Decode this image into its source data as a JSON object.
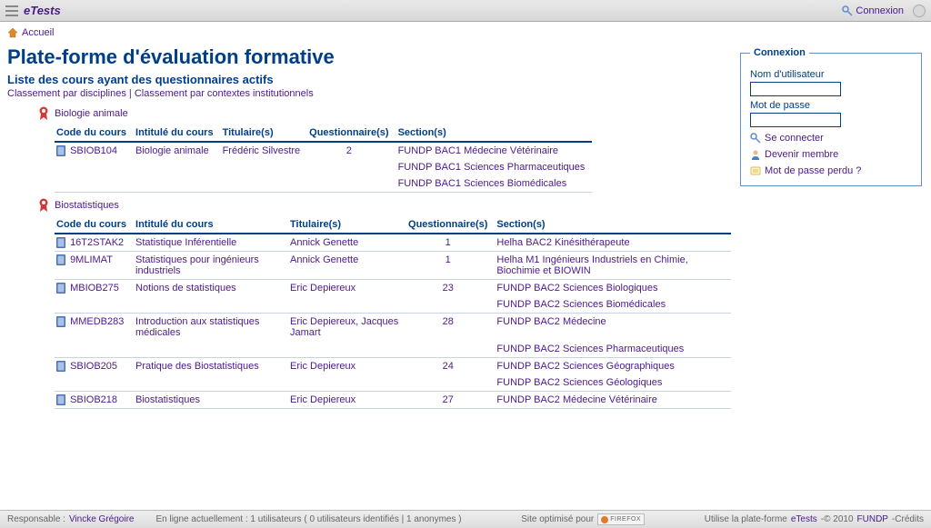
{
  "app": {
    "title": "eTests"
  },
  "titlebar": {
    "connexion": "Connexion"
  },
  "breadcrumb": {
    "home": "Accueil"
  },
  "page": {
    "h1": "Plate-forme d'évaluation formative",
    "h2": "Liste des cours ayant des questionnaires actifs",
    "sort_by_discipline": "Classement par disciplines",
    "sort_sep": " | ",
    "sort_by_context": "Classement par contextes institutionnels"
  },
  "headers": {
    "code": "Code du cours",
    "title": "Intitulé du cours",
    "holders": "Titulaire(s)",
    "quizzes": "Questionnaire(s)",
    "sections": "Section(s)"
  },
  "disciplines": [
    {
      "name": "Biologie animale",
      "courses": [
        {
          "code": "SBIOB104",
          "title": "Biologie animale",
          "holders": "Frédéric Silvestre",
          "quizzes": "2",
          "sections": [
            "FUNDP BAC1 Médecine Vétérinaire",
            "FUNDP BAC1 Sciences Pharmaceutiques",
            "FUNDP BAC1 Sciences Biomédicales"
          ]
        }
      ]
    },
    {
      "name": "Biostatistiques",
      "courses": [
        {
          "code": "16T2STAK2",
          "title": "Statistique Inférentielle",
          "holders": "Annick Genette",
          "quizzes": "1",
          "sections": [
            "Helha BAC2 Kinésithérapeute"
          ]
        },
        {
          "code": "9MLIMAT",
          "title": "Statistiques pour ingénieurs industriels",
          "holders": "Annick Genette",
          "quizzes": "1",
          "sections": [
            "Helha M1 Ingénieurs Industriels en Chimie, Biochimie et BIOWIN"
          ]
        },
        {
          "code": "MBIOB275",
          "title": "Notions de statistiques",
          "holders": "Eric Depiereux",
          "quizzes": "23",
          "sections": [
            "FUNDP BAC2 Sciences Biologiques",
            "FUNDP BAC2 Sciences Biomédicales"
          ]
        },
        {
          "code": "MMEDB283",
          "title": "Introduction aux statistiques médicales",
          "holders": "Eric Depiereux, Jacques Jamart",
          "quizzes": "28",
          "sections": [
            "FUNDP BAC2 Médecine",
            "FUNDP BAC2 Sciences Pharmaceutiques"
          ]
        },
        {
          "code": "SBIOB205",
          "title": "Pratique des Biostatistiques",
          "holders": "Eric Depiereux",
          "quizzes": "24",
          "sections": [
            "FUNDP BAC2 Sciences Géographiques",
            "FUNDP BAC2 Sciences Géologiques"
          ]
        },
        {
          "code": "SBIOB218",
          "title": "Biostatistiques",
          "holders": "Eric Depiereux",
          "quizzes": "27",
          "sections": [
            "FUNDP BAC2 Médecine Vétérinaire"
          ]
        }
      ]
    }
  ],
  "login": {
    "legend": "Connexion",
    "username_label": "Nom d'utilisateur",
    "password_label": "Mot de passe",
    "submit": "Se connecter",
    "register": "Devenir membre",
    "lost": "Mot de passe perdu ?"
  },
  "footer": {
    "resp_label": "Responsable : ",
    "resp_name": "Vincke Grégoire",
    "online": "En ligne actuellement : 1 utilisateurs ( 0 utilisateurs identifiés | 1 anonymes )",
    "optimized": "Site optimisé pour",
    "ff": "FIREFOX",
    "uses1": "Utilise la plate-forme ",
    "etests": "eTests",
    "uses2": "-© 2010 ",
    "fundp": "FUNDP",
    "uses3": "-Crédits"
  }
}
